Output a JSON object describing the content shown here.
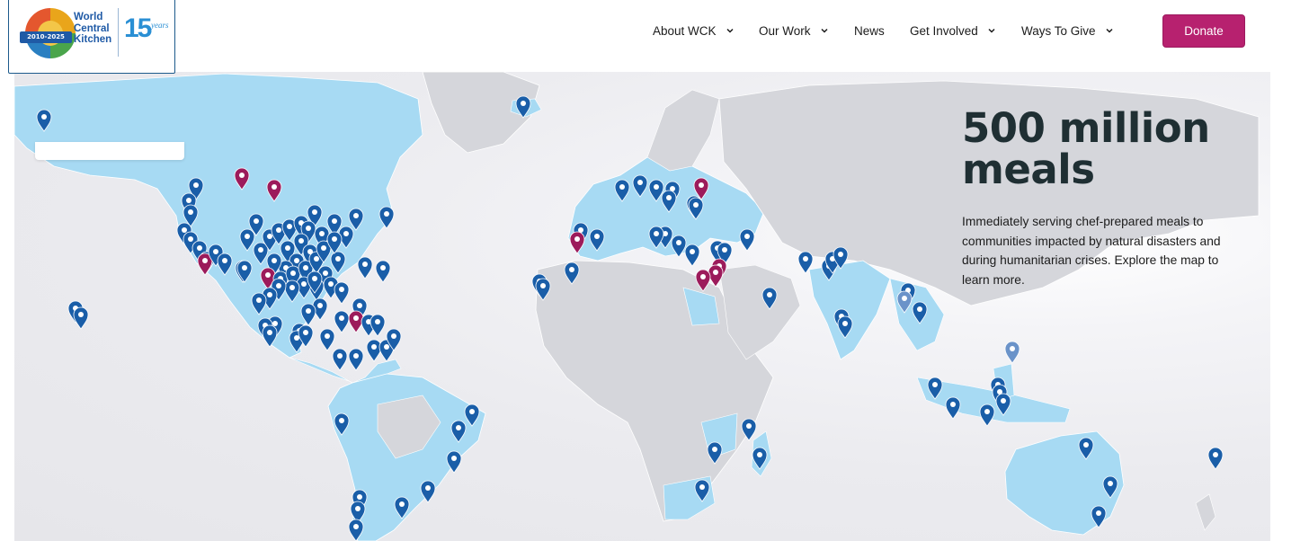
{
  "logo": {
    "name_line1": "World",
    "name_line2": "Central",
    "name_line3": "Kitchen",
    "ribbon": "2010-2025",
    "anniversary_number": "15",
    "anniversary_word": "years"
  },
  "nav": {
    "items": [
      {
        "label": "About WCK",
        "has_dropdown": true
      },
      {
        "label": "Our Work",
        "has_dropdown": true
      },
      {
        "label": "News",
        "has_dropdown": false
      },
      {
        "label": "Get Involved",
        "has_dropdown": true
      },
      {
        "label": "Ways To Give",
        "has_dropdown": true
      }
    ],
    "donate_label": "Donate"
  },
  "hero": {
    "headline": "500 million meals",
    "description": "Immediately serving chef-prepared meals to communities impacted by natural disasters and during humanitarian crises. Explore the map to learn more."
  },
  "map": {
    "land_color": "#d5d6db",
    "served_country_color": "#a7daf3",
    "pin_blue": "#1a5ea8",
    "pin_magenta": "#9c1b5b",
    "pin_light": "#6b93c9",
    "pin_total_visible": 170
  },
  "colors": {
    "brand_magenta": "#b7216f",
    "text_dark": "#1f2f33"
  }
}
